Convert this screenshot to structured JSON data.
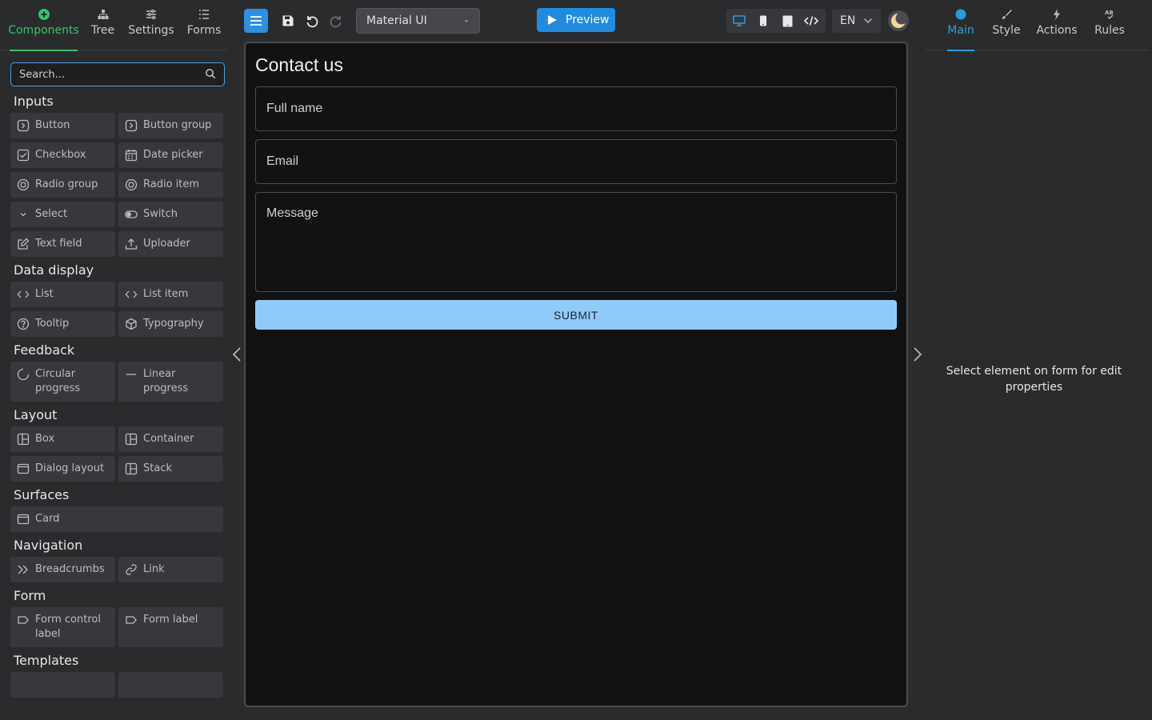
{
  "left_tabs": [
    {
      "label": "Components",
      "icon": "plus-circle-icon"
    },
    {
      "label": "Tree",
      "icon": "tree-icon"
    },
    {
      "label": "Settings",
      "icon": "sliders-icon"
    },
    {
      "label": "Forms",
      "icon": "list-icon"
    }
  ],
  "search": {
    "placeholder": "Search...",
    "value": ""
  },
  "palette": {
    "inputs": {
      "title": "Inputs",
      "items": [
        "Button",
        "Button group",
        "Checkbox",
        "Date picker",
        "Radio group",
        "Radio item",
        "Select",
        "Switch",
        "Text field",
        "Uploader"
      ]
    },
    "data_display": {
      "title": "Data display",
      "items": [
        "List",
        "List item",
        "Tooltip",
        "Typography"
      ]
    },
    "feedback": {
      "title": "Feedback",
      "items": [
        "Circular progress",
        "Linear progress"
      ]
    },
    "layout": {
      "title": "Layout",
      "items": [
        "Box",
        "Container",
        "Dialog layout",
        "Stack"
      ]
    },
    "surfaces": {
      "title": "Surfaces",
      "items": [
        "Card"
      ]
    },
    "navigation": {
      "title": "Navigation",
      "items": [
        "Breadcrumbs",
        "Link"
      ]
    },
    "form": {
      "title": "Form",
      "items": [
        "Form control label",
        "Form label"
      ]
    },
    "templates": {
      "title": "Templates"
    }
  },
  "toolbar": {
    "library": "Material UI",
    "preview_label": "Preview",
    "language": "EN"
  },
  "form": {
    "title": "Contact us",
    "full_name_placeholder": "Full name",
    "email_placeholder": "Email",
    "message_placeholder": "Message",
    "submit_label": "SUBMIT"
  },
  "right_tabs": [
    {
      "label": "Main",
      "icon": "dot-icon"
    },
    {
      "label": "Style",
      "icon": "brush-icon"
    },
    {
      "label": "Actions",
      "icon": "bolt-icon"
    },
    {
      "label": "Rules",
      "icon": "rules-icon"
    }
  ],
  "right_hint": "Select element on form for edit properties",
  "colors": {
    "accent_green": "#35c46a",
    "accent_blue": "#2d9cdb",
    "submit_bg": "#90caf9"
  }
}
